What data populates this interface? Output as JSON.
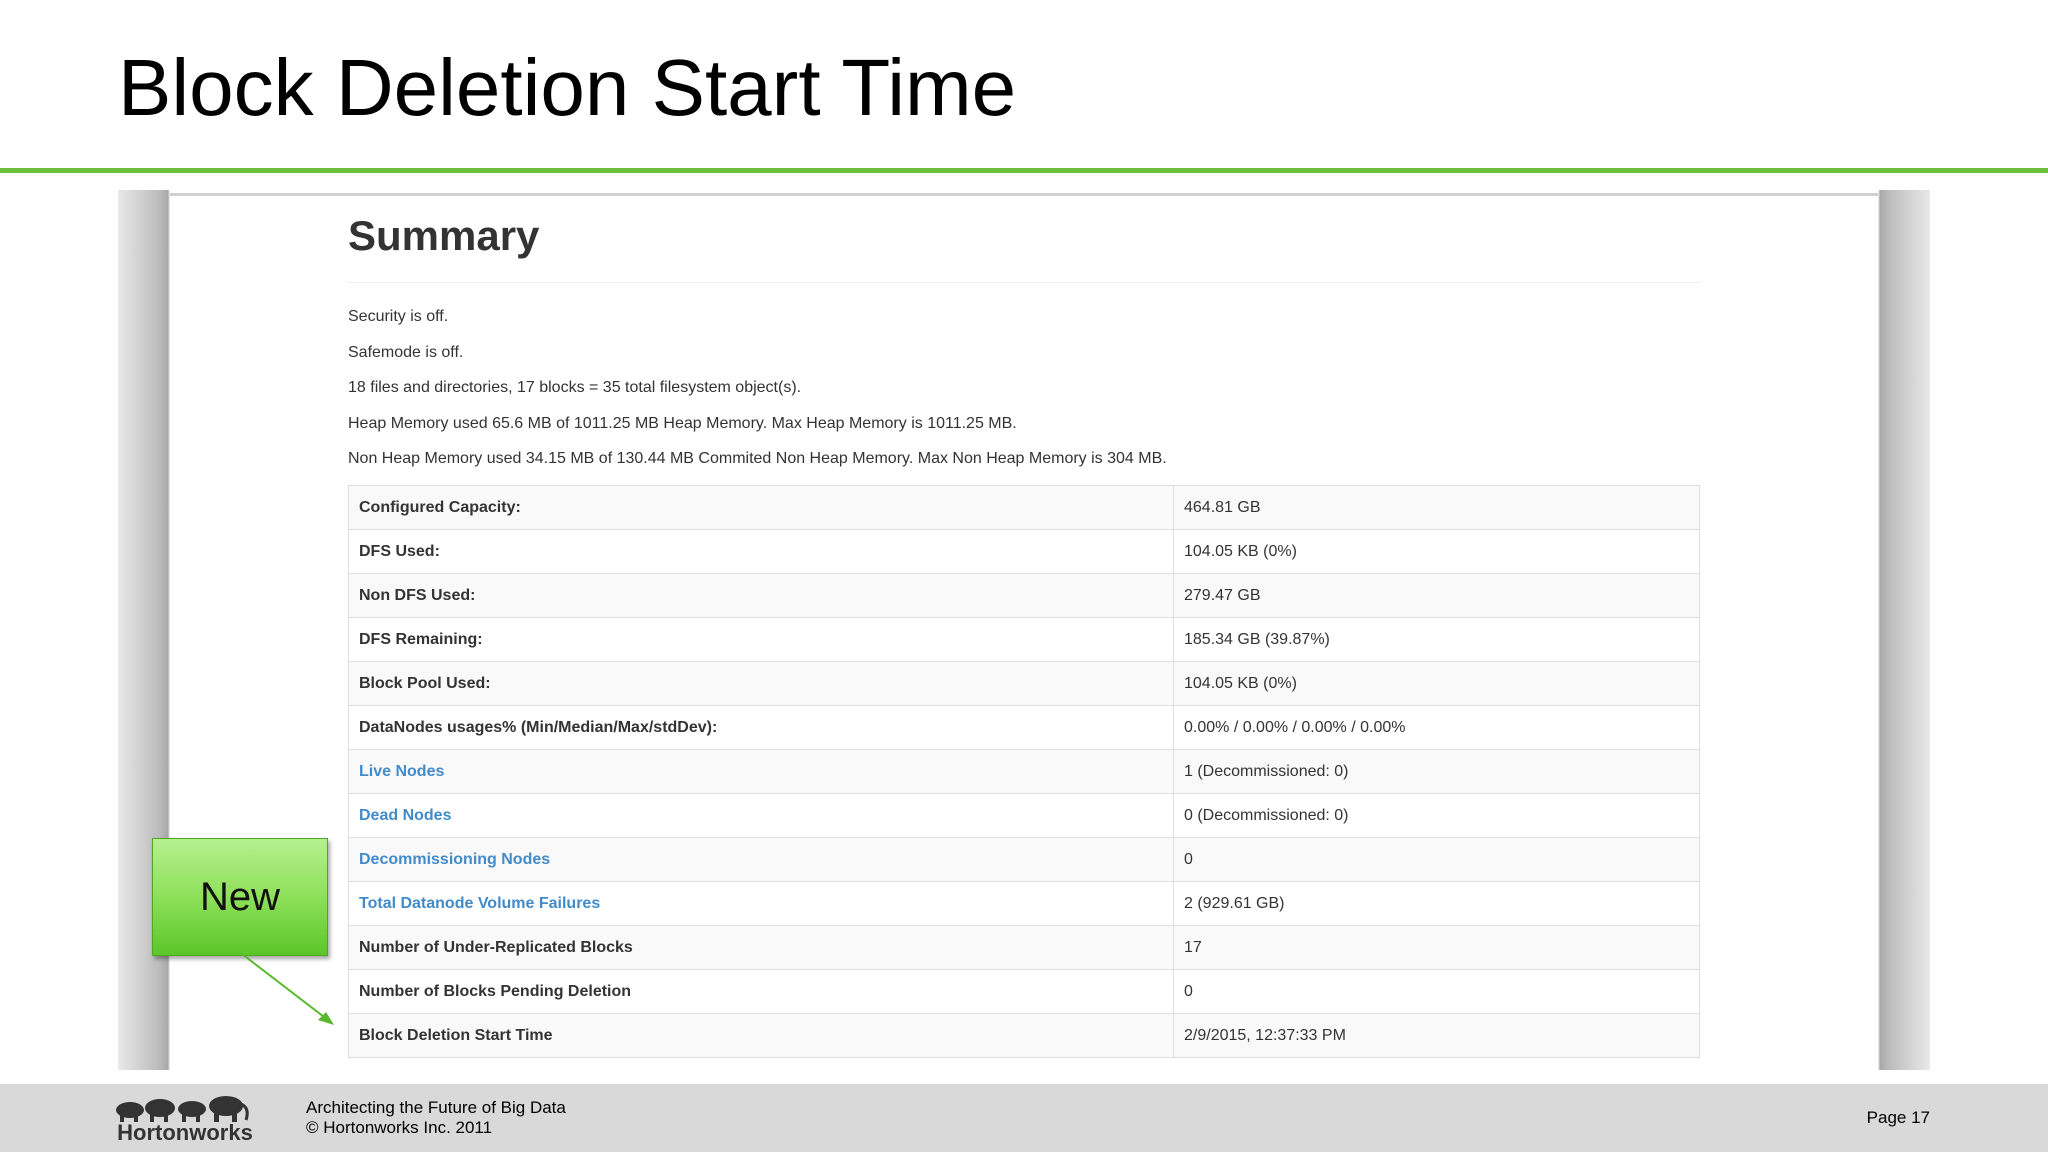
{
  "slide": {
    "title": "Block Deletion Start Time"
  },
  "summary": {
    "heading": "Summary",
    "lines": [
      "Security is off.",
      "Safemode is off.",
      "18 files and directories, 17 blocks = 35 total filesystem object(s).",
      "Heap Memory used 65.6 MB of 1011.25 MB Heap Memory. Max Heap Memory is 1011.25 MB.",
      "Non Heap Memory used 34.15 MB of 130.44 MB Commited Non Heap Memory. Max Non Heap Memory is 304 MB."
    ],
    "rows": [
      {
        "key": "Configured Capacity:",
        "value": "464.81 GB"
      },
      {
        "key": "DFS Used:",
        "value": "104.05 KB (0%)"
      },
      {
        "key": "Non DFS Used:",
        "value": "279.47 GB"
      },
      {
        "key": "DFS Remaining:",
        "value": "185.34 GB (39.87%)"
      },
      {
        "key": "Block Pool Used:",
        "value": "104.05 KB (0%)"
      },
      {
        "key": "DataNodes usages% (Min/Median/Max/stdDev):",
        "value": "0.00% / 0.00% / 0.00% / 0.00%"
      },
      {
        "key": "Live Nodes",
        "value": "1 (Decommissioned: 0)"
      },
      {
        "key": "Dead Nodes",
        "value": "0 (Decommissioned: 0)"
      },
      {
        "key": "Decommissioning Nodes",
        "value": "0"
      },
      {
        "key": "Total Datanode Volume Failures",
        "value": "2 (929.61 GB)"
      },
      {
        "key": "Number of Under-Replicated Blocks",
        "value": "17"
      },
      {
        "key": "Number of Blocks Pending Deletion",
        "value": "0"
      },
      {
        "key": "Block Deletion Start Time",
        "value": "2/9/2015, 12:37:33 PM"
      }
    ]
  },
  "callout": {
    "label": "New"
  },
  "footer": {
    "logo_text": "Hortonworks",
    "line1": "Architecting the Future of Big Data",
    "line2": "© Hortonworks Inc. 2011",
    "page": "Page 17"
  },
  "colors": {
    "accent_rule": "#6cbf3a",
    "link": "#428bca",
    "callout_green": "#8ee05a",
    "footer_bg": "#d9d9d9"
  }
}
